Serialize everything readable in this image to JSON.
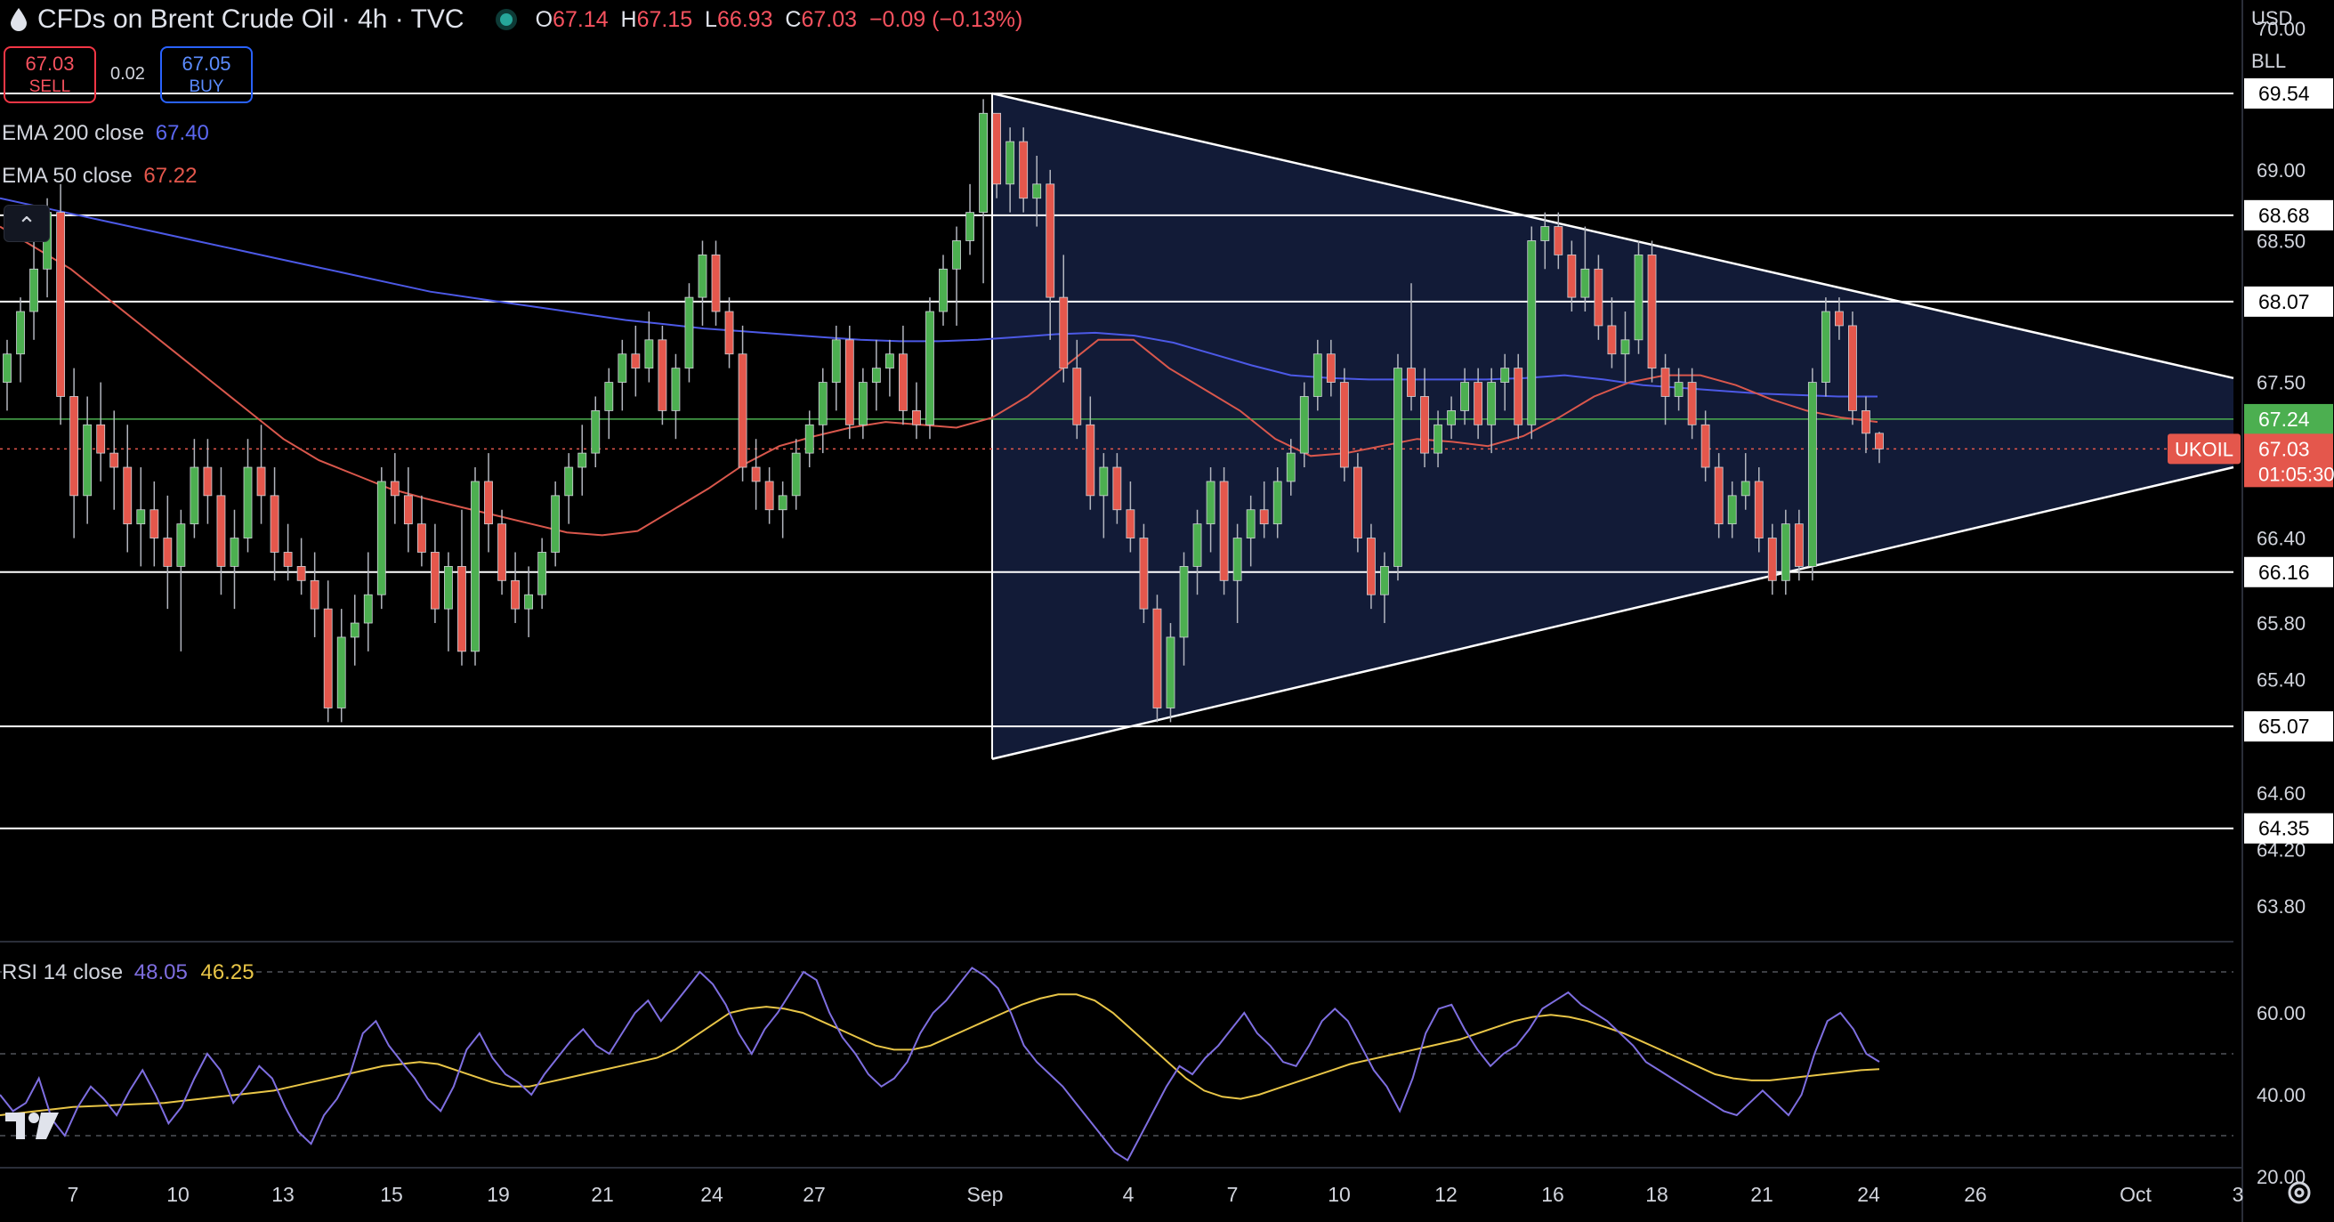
{
  "header": {
    "title": "CFDs on Brent Crude Oil · 4h · TVC",
    "ohlc": [
      {
        "k": "O",
        "v": "67.14"
      },
      {
        "k": "H",
        "v": "67.15"
      },
      {
        "k": "L",
        "v": "66.93"
      },
      {
        "k": "C",
        "v": "67.03"
      },
      {
        "k": "",
        "v": "−0.09 (−0.13%)"
      }
    ]
  },
  "trade": {
    "sell_price": "67.03",
    "sell_label": "SELL",
    "buy_price": "67.05",
    "buy_label": "BUY",
    "spread": "0.02"
  },
  "indicators": {
    "ema200": {
      "label": "EMA 200 close",
      "value": "67.40",
      "color": "#4c59e6"
    },
    "ema50": {
      "label": "EMA 50 close",
      "value": "67.22",
      "color": "#d9574c"
    },
    "rsi": {
      "label": "RSI 14 close",
      "value": "48.05",
      "ma_value": "46.25",
      "color": "#7e6ee0",
      "ma_color": "#e8c547"
    }
  },
  "scale": {
    "currency": "USD",
    "unit": "BLL"
  },
  "colors": {
    "up": "#4caf50",
    "down": "#e4574c",
    "triangle_fill": "#131c3a"
  },
  "chart_data": {
    "type": "candlestick",
    "symbol": "UKOIL",
    "timeframe": "4h",
    "ylim": [
      63.55,
      70.2
    ],
    "y_ticks": [
      "70.00",
      "69.00",
      "68.50",
      "67.50",
      "66.40",
      "65.80",
      "65.40",
      "64.60",
      "64.20",
      "63.80"
    ],
    "x_ticks": [
      "7",
      "10",
      "13",
      "15",
      "19",
      "21",
      "24",
      "27",
      "Sep",
      "4",
      "7",
      "10",
      "12",
      "16",
      "18",
      "21",
      "24",
      "26",
      "Oct",
      "3"
    ],
    "price_badge": {
      "symbol": "UKOIL",
      "price": "67.03",
      "countdown": "01:05:30"
    },
    "levels": [
      "69.54",
      "68.68",
      "68.07",
      "67.24",
      "66.16",
      "65.07",
      "64.35"
    ],
    "rsi_ticks": [
      "60.00",
      "40.00",
      "20.00"
    ],
    "rsi_bands": [
      30,
      50,
      70
    ],
    "candles": [
      {
        "o": 67.5,
        "h": 67.8,
        "l": 67.3,
        "c": 67.7
      },
      {
        "o": 67.7,
        "h": 68.1,
        "l": 67.5,
        "c": 68.0
      },
      {
        "o": 68.0,
        "h": 68.5,
        "l": 67.8,
        "c": 68.3
      },
      {
        "o": 68.3,
        "h": 68.8,
        "l": 68.1,
        "c": 68.7
      },
      {
        "o": 68.7,
        "h": 68.9,
        "l": 67.2,
        "c": 67.4
      },
      {
        "o": 67.4,
        "h": 67.6,
        "l": 66.4,
        "c": 66.7
      },
      {
        "o": 66.7,
        "h": 67.4,
        "l": 66.5,
        "c": 67.2
      },
      {
        "o": 67.2,
        "h": 67.5,
        "l": 66.8,
        "c": 67.0
      },
      {
        "o": 67.0,
        "h": 67.3,
        "l": 66.6,
        "c": 66.9
      },
      {
        "o": 66.9,
        "h": 67.2,
        "l": 66.3,
        "c": 66.5
      },
      {
        "o": 66.5,
        "h": 66.9,
        "l": 66.2,
        "c": 66.6
      },
      {
        "o": 66.6,
        "h": 66.8,
        "l": 66.2,
        "c": 66.4
      },
      {
        "o": 66.4,
        "h": 66.7,
        "l": 65.9,
        "c": 66.2
      },
      {
        "o": 66.2,
        "h": 66.6,
        "l": 65.6,
        "c": 66.5
      },
      {
        "o": 66.5,
        "h": 67.1,
        "l": 66.4,
        "c": 66.9
      },
      {
        "o": 66.9,
        "h": 67.1,
        "l": 66.5,
        "c": 66.7
      },
      {
        "o": 66.7,
        "h": 66.9,
        "l": 66.0,
        "c": 66.2
      },
      {
        "o": 66.2,
        "h": 66.6,
        "l": 65.9,
        "c": 66.4
      },
      {
        "o": 66.4,
        "h": 67.1,
        "l": 66.3,
        "c": 66.9
      },
      {
        "o": 66.9,
        "h": 67.2,
        "l": 66.5,
        "c": 66.7
      },
      {
        "o": 66.7,
        "h": 66.9,
        "l": 66.1,
        "c": 66.3
      },
      {
        "o": 66.3,
        "h": 66.5,
        "l": 66.1,
        "c": 66.2
      },
      {
        "o": 66.2,
        "h": 66.4,
        "l": 66.0,
        "c": 66.1
      },
      {
        "o": 66.1,
        "h": 66.3,
        "l": 65.7,
        "c": 65.9
      },
      {
        "o": 65.9,
        "h": 66.1,
        "l": 65.1,
        "c": 65.2
      },
      {
        "o": 65.2,
        "h": 65.9,
        "l": 65.1,
        "c": 65.7
      },
      {
        "o": 65.7,
        "h": 66.0,
        "l": 65.5,
        "c": 65.8
      },
      {
        "o": 65.8,
        "h": 66.3,
        "l": 65.6,
        "c": 66.0
      },
      {
        "o": 66.0,
        "h": 66.9,
        "l": 65.9,
        "c": 66.8
      },
      {
        "o": 66.8,
        "h": 67.0,
        "l": 66.5,
        "c": 66.7
      },
      {
        "o": 66.7,
        "h": 66.9,
        "l": 66.3,
        "c": 66.5
      },
      {
        "o": 66.5,
        "h": 66.7,
        "l": 66.2,
        "c": 66.3
      },
      {
        "o": 66.3,
        "h": 66.5,
        "l": 65.8,
        "c": 65.9
      },
      {
        "o": 65.9,
        "h": 66.3,
        "l": 65.6,
        "c": 66.2
      },
      {
        "o": 66.2,
        "h": 66.6,
        "l": 65.5,
        "c": 65.6
      },
      {
        "o": 65.6,
        "h": 66.9,
        "l": 65.5,
        "c": 66.8
      },
      {
        "o": 66.8,
        "h": 67.0,
        "l": 66.3,
        "c": 66.5
      },
      {
        "o": 66.5,
        "h": 66.6,
        "l": 66.0,
        "c": 66.1
      },
      {
        "o": 66.1,
        "h": 66.3,
        "l": 65.8,
        "c": 65.9
      },
      {
        "o": 65.9,
        "h": 66.2,
        "l": 65.7,
        "c": 66.0
      },
      {
        "o": 66.0,
        "h": 66.4,
        "l": 65.9,
        "c": 66.3
      },
      {
        "o": 66.3,
        "h": 66.8,
        "l": 66.2,
        "c": 66.7
      },
      {
        "o": 66.7,
        "h": 67.0,
        "l": 66.5,
        "c": 66.9
      },
      {
        "o": 66.9,
        "h": 67.2,
        "l": 66.7,
        "c": 67.0
      },
      {
        "o": 67.0,
        "h": 67.4,
        "l": 66.9,
        "c": 67.3
      },
      {
        "o": 67.3,
        "h": 67.6,
        "l": 67.1,
        "c": 67.5
      },
      {
        "o": 67.5,
        "h": 67.8,
        "l": 67.3,
        "c": 67.7
      },
      {
        "o": 67.7,
        "h": 67.9,
        "l": 67.4,
        "c": 67.6
      },
      {
        "o": 67.6,
        "h": 68.0,
        "l": 67.5,
        "c": 67.8
      },
      {
        "o": 67.8,
        "h": 67.9,
        "l": 67.2,
        "c": 67.3
      },
      {
        "o": 67.3,
        "h": 67.7,
        "l": 67.1,
        "c": 67.6
      },
      {
        "o": 67.6,
        "h": 68.2,
        "l": 67.5,
        "c": 68.1
      },
      {
        "o": 68.1,
        "h": 68.5,
        "l": 67.9,
        "c": 68.4
      },
      {
        "o": 68.4,
        "h": 68.5,
        "l": 67.9,
        "c": 68.0
      },
      {
        "o": 68.0,
        "h": 68.1,
        "l": 67.6,
        "c": 67.7
      },
      {
        "o": 67.7,
        "h": 67.9,
        "l": 66.8,
        "c": 66.9
      },
      {
        "o": 66.9,
        "h": 67.1,
        "l": 66.6,
        "c": 66.8
      },
      {
        "o": 66.8,
        "h": 66.9,
        "l": 66.5,
        "c": 66.6
      },
      {
        "o": 66.6,
        "h": 66.8,
        "l": 66.4,
        "c": 66.7
      },
      {
        "o": 66.7,
        "h": 67.1,
        "l": 66.6,
        "c": 67.0
      },
      {
        "o": 67.0,
        "h": 67.3,
        "l": 66.9,
        "c": 67.2
      },
      {
        "o": 67.2,
        "h": 67.6,
        "l": 67.0,
        "c": 67.5
      },
      {
        "o": 67.5,
        "h": 67.9,
        "l": 67.3,
        "c": 67.8
      },
      {
        "o": 67.8,
        "h": 67.9,
        "l": 67.1,
        "c": 67.2
      },
      {
        "o": 67.2,
        "h": 67.6,
        "l": 67.1,
        "c": 67.5
      },
      {
        "o": 67.5,
        "h": 67.8,
        "l": 67.3,
        "c": 67.6
      },
      {
        "o": 67.6,
        "h": 67.8,
        "l": 67.4,
        "c": 67.7
      },
      {
        "o": 67.7,
        "h": 67.9,
        "l": 67.2,
        "c": 67.3
      },
      {
        "o": 67.3,
        "h": 67.5,
        "l": 67.1,
        "c": 67.2
      },
      {
        "o": 67.2,
        "h": 68.1,
        "l": 67.1,
        "c": 68.0
      },
      {
        "o": 68.0,
        "h": 68.4,
        "l": 67.9,
        "c": 68.3
      },
      {
        "o": 68.3,
        "h": 68.6,
        "l": 67.9,
        "c": 68.5
      },
      {
        "o": 68.5,
        "h": 68.9,
        "l": 68.4,
        "c": 68.7
      },
      {
        "o": 68.7,
        "h": 69.5,
        "l": 68.2,
        "c": 69.4
      },
      {
        "o": 69.4,
        "h": 69.4,
        "l": 68.8,
        "c": 68.9
      },
      {
        "o": 68.9,
        "h": 69.3,
        "l": 68.7,
        "c": 69.2
      },
      {
        "o": 69.2,
        "h": 69.3,
        "l": 68.7,
        "c": 68.8
      },
      {
        "o": 68.8,
        "h": 69.1,
        "l": 68.6,
        "c": 68.9
      },
      {
        "o": 68.9,
        "h": 69.0,
        "l": 67.8,
        "c": 68.1
      },
      {
        "o": 68.1,
        "h": 68.4,
        "l": 67.5,
        "c": 67.6
      },
      {
        "o": 67.6,
        "h": 67.8,
        "l": 67.1,
        "c": 67.2
      },
      {
        "o": 67.2,
        "h": 67.4,
        "l": 66.6,
        "c": 66.7
      },
      {
        "o": 66.7,
        "h": 67.0,
        "l": 66.4,
        "c": 66.9
      },
      {
        "o": 66.9,
        "h": 67.0,
        "l": 66.5,
        "c": 66.6
      },
      {
        "o": 66.6,
        "h": 66.8,
        "l": 66.3,
        "c": 66.4
      },
      {
        "o": 66.4,
        "h": 66.5,
        "l": 65.8,
        "c": 65.9
      },
      {
        "o": 65.9,
        "h": 66.0,
        "l": 65.1,
        "c": 65.2
      },
      {
        "o": 65.2,
        "h": 65.8,
        "l": 65.1,
        "c": 65.7
      },
      {
        "o": 65.7,
        "h": 66.3,
        "l": 65.5,
        "c": 66.2
      },
      {
        "o": 66.2,
        "h": 66.6,
        "l": 66.0,
        "c": 66.5
      },
      {
        "o": 66.5,
        "h": 66.9,
        "l": 66.3,
        "c": 66.8
      },
      {
        "o": 66.8,
        "h": 66.9,
        "l": 66.0,
        "c": 66.1
      },
      {
        "o": 66.1,
        "h": 66.5,
        "l": 65.8,
        "c": 66.4
      },
      {
        "o": 66.4,
        "h": 66.7,
        "l": 66.2,
        "c": 66.6
      },
      {
        "o": 66.6,
        "h": 66.8,
        "l": 66.4,
        "c": 66.5
      },
      {
        "o": 66.5,
        "h": 66.9,
        "l": 66.4,
        "c": 66.8
      },
      {
        "o": 66.8,
        "h": 67.1,
        "l": 66.7,
        "c": 67.0
      },
      {
        "o": 67.0,
        "h": 67.5,
        "l": 66.9,
        "c": 67.4
      },
      {
        "o": 67.4,
        "h": 67.8,
        "l": 67.3,
        "c": 67.7
      },
      {
        "o": 67.7,
        "h": 67.8,
        "l": 67.4,
        "c": 67.5
      },
      {
        "o": 67.5,
        "h": 67.6,
        "l": 66.8,
        "c": 66.9
      },
      {
        "o": 66.9,
        "h": 67.0,
        "l": 66.3,
        "c": 66.4
      },
      {
        "o": 66.4,
        "h": 66.5,
        "l": 65.9,
        "c": 66.0
      },
      {
        "o": 66.0,
        "h": 66.3,
        "l": 65.8,
        "c": 66.2
      },
      {
        "o": 66.2,
        "h": 67.7,
        "l": 66.1,
        "c": 67.6
      },
      {
        "o": 67.6,
        "h": 68.2,
        "l": 67.3,
        "c": 67.4
      },
      {
        "o": 67.4,
        "h": 67.6,
        "l": 66.9,
        "c": 67.0
      },
      {
        "o": 67.0,
        "h": 67.3,
        "l": 66.9,
        "c": 67.2
      },
      {
        "o": 67.2,
        "h": 67.4,
        "l": 67.1,
        "c": 67.3
      },
      {
        "o": 67.3,
        "h": 67.6,
        "l": 67.2,
        "c": 67.5
      },
      {
        "o": 67.5,
        "h": 67.6,
        "l": 67.1,
        "c": 67.2
      },
      {
        "o": 67.2,
        "h": 67.6,
        "l": 67.0,
        "c": 67.5
      },
      {
        "o": 67.5,
        "h": 67.7,
        "l": 67.3,
        "c": 67.6
      },
      {
        "o": 67.6,
        "h": 67.7,
        "l": 67.1,
        "c": 67.2
      },
      {
        "o": 67.2,
        "h": 68.6,
        "l": 67.1,
        "c": 68.5
      },
      {
        "o": 68.5,
        "h": 68.7,
        "l": 68.3,
        "c": 68.6
      },
      {
        "o": 68.6,
        "h": 68.7,
        "l": 68.3,
        "c": 68.4
      },
      {
        "o": 68.4,
        "h": 68.5,
        "l": 68.0,
        "c": 68.1
      },
      {
        "o": 68.1,
        "h": 68.6,
        "l": 68.0,
        "c": 68.3
      },
      {
        "o": 68.3,
        "h": 68.4,
        "l": 67.8,
        "c": 67.9
      },
      {
        "o": 67.9,
        "h": 68.1,
        "l": 67.6,
        "c": 67.7
      },
      {
        "o": 67.7,
        "h": 68.0,
        "l": 67.5,
        "c": 67.8
      },
      {
        "o": 67.8,
        "h": 68.5,
        "l": 67.7,
        "c": 68.4
      },
      {
        "o": 68.4,
        "h": 68.5,
        "l": 67.5,
        "c": 67.6
      },
      {
        "o": 67.6,
        "h": 67.7,
        "l": 67.2,
        "c": 67.4
      },
      {
        "o": 67.4,
        "h": 67.6,
        "l": 67.3,
        "c": 67.5
      },
      {
        "o": 67.5,
        "h": 67.6,
        "l": 67.1,
        "c": 67.2
      },
      {
        "o": 67.2,
        "h": 67.3,
        "l": 66.8,
        "c": 66.9
      },
      {
        "o": 66.9,
        "h": 67.0,
        "l": 66.4,
        "c": 66.5
      },
      {
        "o": 66.5,
        "h": 66.8,
        "l": 66.4,
        "c": 66.7
      },
      {
        "o": 66.7,
        "h": 67.0,
        "l": 66.6,
        "c": 66.8
      },
      {
        "o": 66.8,
        "h": 66.9,
        "l": 66.3,
        "c": 66.4
      },
      {
        "o": 66.4,
        "h": 66.5,
        "l": 66.0,
        "c": 66.1
      },
      {
        "o": 66.1,
        "h": 66.6,
        "l": 66.0,
        "c": 66.5
      },
      {
        "o": 66.5,
        "h": 66.6,
        "l": 66.1,
        "c": 66.2
      },
      {
        "o": 66.2,
        "h": 67.6,
        "l": 66.1,
        "c": 67.5
      },
      {
        "o": 67.5,
        "h": 68.1,
        "l": 67.4,
        "c": 68.0
      },
      {
        "o": 68.0,
        "h": 68.1,
        "l": 67.8,
        "c": 67.9
      },
      {
        "o": 67.9,
        "h": 68.0,
        "l": 67.2,
        "c": 67.3
      },
      {
        "o": 67.3,
        "h": 67.4,
        "l": 67.0,
        "c": 67.14
      },
      {
        "o": 67.14,
        "h": 67.15,
        "l": 66.93,
        "c": 67.03
      }
    ],
    "ema200": [
      68.8,
      68.74,
      68.68,
      68.62,
      68.56,
      68.5,
      68.44,
      68.38,
      68.32,
      68.26,
      68.2,
      68.14,
      68.1,
      68.06,
      68.02,
      67.98,
      67.94,
      67.91,
      67.88,
      67.86,
      67.84,
      67.82,
      67.8,
      67.79,
      67.79,
      67.8,
      67.82,
      67.84,
      67.85,
      67.83,
      67.78,
      67.7,
      67.62,
      67.55,
      67.53,
      67.52,
      67.52,
      67.52,
      67.52,
      67.53,
      67.55,
      67.52,
      67.48,
      67.46,
      67.44,
      67.42,
      67.41,
      67.4,
      67.4
    ],
    "ema50": [
      68.6,
      68.45,
      68.3,
      68.1,
      67.9,
      67.7,
      67.5,
      67.3,
      67.1,
      66.95,
      66.85,
      66.75,
      66.68,
      66.62,
      66.56,
      66.5,
      66.44,
      66.42,
      66.45,
      66.6,
      66.75,
      66.92,
      67.05,
      67.12,
      67.18,
      67.22,
      67.2,
      67.18,
      67.25,
      67.4,
      67.6,
      67.8,
      67.8,
      67.6,
      67.45,
      67.3,
      67.1,
      66.98,
      67.0,
      67.05,
      67.1,
      67.08,
      67.05,
      67.12,
      67.25,
      67.4,
      67.5,
      67.55,
      67.55,
      67.48,
      67.38,
      67.3,
      67.25,
      67.22
    ],
    "rsi": [
      40,
      36,
      38,
      44,
      34,
      30,
      37,
      42,
      39,
      35,
      41,
      46,
      40,
      33,
      37,
      44,
      50,
      46,
      38,
      42,
      47,
      44,
      37,
      31,
      28,
      35,
      39,
      45,
      55,
      58,
      52,
      48,
      44,
      39,
      36,
      42,
      51,
      55,
      49,
      45,
      43,
      40,
      45,
      49,
      53,
      56,
      52,
      50,
      55,
      60,
      63,
      58,
      62,
      66,
      70,
      67,
      62,
      55,
      50,
      56,
      60,
      65,
      70,
      68,
      60,
      54,
      50,
      45,
      42,
      44,
      48,
      55,
      60,
      63,
      67,
      71,
      69,
      66,
      60,
      52,
      48,
      45,
      42,
      38,
      34,
      30,
      26,
      24,
      30,
      36,
      42,
      47,
      45,
      49,
      52,
      56,
      60,
      55,
      52,
      48,
      47,
      52,
      58,
      61,
      58,
      52,
      46,
      42,
      36,
      44,
      55,
      61,
      62,
      56,
      51,
      47,
      50,
      52,
      56,
      61,
      63,
      65,
      62,
      60,
      58,
      55,
      52,
      48,
      46,
      44,
      42,
      40,
      38,
      36,
      35,
      38,
      41,
      38,
      35,
      40,
      50,
      58,
      60,
      56,
      50,
      48.05
    ],
    "rsi_ma": [
      35,
      35.5,
      36,
      36.5,
      37,
      37.2,
      37.4,
      37.6,
      37.8,
      38,
      38.5,
      39,
      39.5,
      40,
      40.5,
      41,
      42,
      43,
      44,
      45,
      46,
      47,
      47.5,
      48,
      47.5,
      46,
      44.5,
      43,
      42,
      42,
      43,
      44,
      45,
      46,
      47,
      48,
      49,
      51,
      54,
      57,
      60,
      61,
      61.5,
      61,
      60,
      58,
      56,
      54,
      52,
      51,
      51,
      52,
      54,
      56,
      58,
      60,
      62,
      63.5,
      64.5,
      64.5,
      63,
      60,
      56,
      52,
      48,
      44,
      41,
      39.5,
      39,
      40,
      41.5,
      43,
      44.5,
      46,
      47.5,
      48.5,
      49.5,
      50.5,
      51.5,
      52.5,
      53.5,
      55,
      56.5,
      58,
      59,
      59.5,
      59,
      58,
      56.5,
      55,
      53,
      51,
      49,
      47,
      45,
      44,
      43.5,
      43.5,
      44,
      44.5,
      45,
      45.5,
      46,
      46.25
    ]
  }
}
